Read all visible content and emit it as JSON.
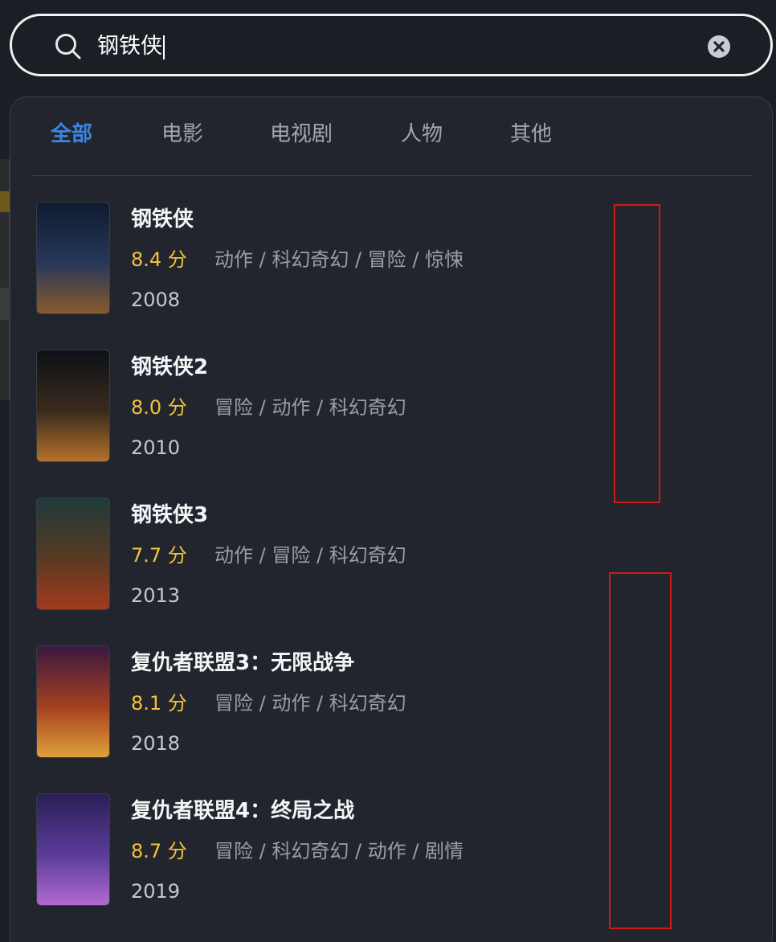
{
  "search": {
    "query": "钢铁侠"
  },
  "tabs": [
    {
      "label": "全部",
      "active": true
    },
    {
      "label": "电影",
      "active": false
    },
    {
      "label": "电视剧",
      "active": false
    },
    {
      "label": "人物",
      "active": false
    },
    {
      "label": "其他",
      "active": false
    }
  ],
  "results": [
    {
      "title": "钢铁侠",
      "rating": "8.4 分",
      "genres": "动作 / 科幻奇幻 / 冒险 / 惊悚",
      "year": "2008",
      "poster_colors": [
        "#0f1a2e",
        "#27385a",
        "#8a5a2c"
      ]
    },
    {
      "title": "钢铁侠2",
      "rating": "8.0 分",
      "genres": "冒险 / 动作 / 科幻奇幻",
      "year": "2010",
      "poster_colors": [
        "#0c1118",
        "#3b2a1c",
        "#b5722a"
      ]
    },
    {
      "title": "钢铁侠3",
      "rating": "7.7 分",
      "genres": "动作 / 冒险 / 科幻奇幻",
      "year": "2013",
      "poster_colors": [
        "#1d3a3a",
        "#5a3a22",
        "#a33a1e"
      ]
    },
    {
      "title": "复仇者联盟3：无限战争",
      "rating": "8.1 分",
      "genres": "冒险 / 动作 / 科幻奇幻",
      "year": "2018",
      "poster_colors": [
        "#3a1840",
        "#a5401f",
        "#e0a03a"
      ]
    },
    {
      "title": "复仇者联盟4：终局之战",
      "rating": "8.7 分",
      "genres": "冒险 / 科幻奇幻 / 动作 / 剧情",
      "year": "2019",
      "poster_colors": [
        "#2a1f56",
        "#5b3c9a",
        "#b06ad0"
      ]
    }
  ],
  "colors": {
    "accent": "#3d84e0",
    "rating": "#f2c33a",
    "background": "#1b1e24",
    "panel": "#22252d",
    "annotation_box": "#d11a1a"
  }
}
